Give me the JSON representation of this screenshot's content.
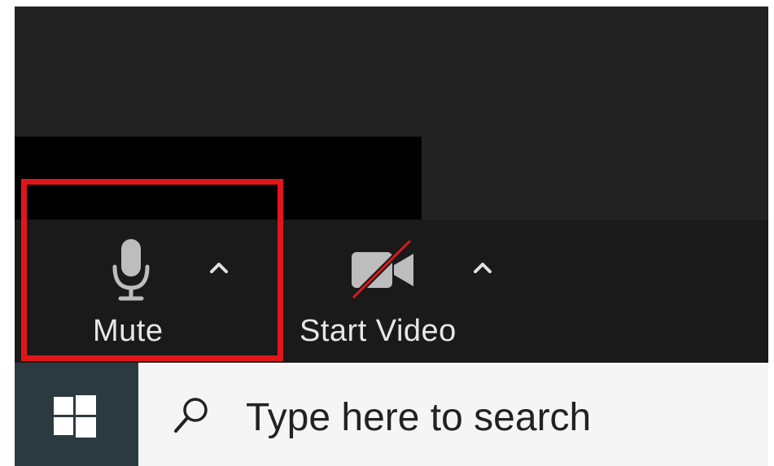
{
  "meeting_toolbar": {
    "mute": {
      "label": "Mute",
      "icon": "microphone-icon"
    },
    "mute_options": {
      "icon": "chevron-up-icon"
    },
    "video": {
      "label": "Start Video",
      "icon": "video-off-icon"
    },
    "video_options": {
      "icon": "chevron-up-icon"
    }
  },
  "annotation": {
    "highlight_color": "#e0161b",
    "target": "mute-button"
  },
  "taskbar": {
    "start_icon": "windows-logo-icon",
    "search": {
      "icon": "search-icon",
      "placeholder": "Type here to search"
    }
  },
  "colors": {
    "toolbar_bg": "#1a1a1a",
    "taskbar_start_bg": "#2b3a40",
    "video_off_slash": "#e0161b"
  }
}
